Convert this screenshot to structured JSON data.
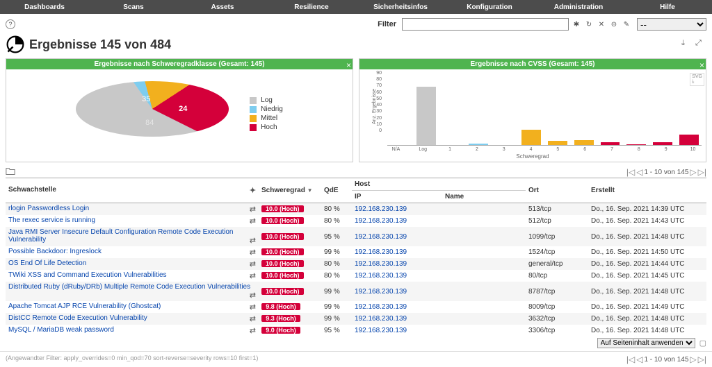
{
  "nav": {
    "items": [
      "Dashboards",
      "Scans",
      "Assets",
      "Resilience",
      "Sicherheitsinfos",
      "Konfiguration",
      "Administration",
      "Hilfe"
    ]
  },
  "filter": {
    "label": "Filter",
    "placeholder": "",
    "value": "",
    "dash": "--"
  },
  "header": {
    "title": "Ergebnisse 145 von 484"
  },
  "panel_pie": {
    "title": "Ergebnisse nach Schweregradklasse (Gesamt: 145)",
    "legend": [
      {
        "label": "Log",
        "color": "#c8c8c8"
      },
      {
        "label": "Niedrig",
        "color": "#7ecdef"
      },
      {
        "label": "Mittel",
        "color": "#f2b01e"
      },
      {
        "label": "Hoch",
        "color": "#d4003a"
      }
    ],
    "slices": {
      "log": 84,
      "niedrig": 2,
      "mittel": 35,
      "hoch": 24
    }
  },
  "panel_bar": {
    "title": "Ergebnisse nach CVSS (Gesamt: 145)",
    "ylabel": "Anz. Ergebnisse",
    "xlabel": "Schweregrad"
  },
  "chart_data": [
    {
      "type": "pie",
      "title": "Ergebnisse nach Schweregradklasse (Gesamt: 145)",
      "categories": [
        "Log",
        "Niedrig",
        "Mittel",
        "Hoch"
      ],
      "values": [
        84,
        2,
        35,
        24
      ],
      "colors": [
        "#c8c8c8",
        "#7ecdef",
        "#f2b01e",
        "#d4003a"
      ]
    },
    {
      "type": "bar",
      "title": "Ergebnisse nach CVSS (Gesamt: 145)",
      "categories": [
        "N/A",
        "Log",
        "1",
        "2",
        "3",
        "4",
        "5",
        "6",
        "7",
        "8",
        "9",
        "10"
      ],
      "values": [
        0,
        84,
        0,
        2,
        0,
        22,
        6,
        7,
        4,
        1,
        4,
        15
      ],
      "colors": [
        "#c8c8c8",
        "#c8c8c8",
        "#7ecdef",
        "#7ecdef",
        "#7ecdef",
        "#f2b01e",
        "#f2b01e",
        "#f2b01e",
        "#d4003a",
        "#d4003a",
        "#d4003a",
        "#d4003a"
      ],
      "xlabel": "Schweregrad",
      "ylabel": "Anz. Ergebnisse",
      "ylim": [
        0,
        90
      ],
      "yticks": [
        0,
        10,
        20,
        30,
        40,
        50,
        60,
        70,
        80,
        90
      ]
    }
  ],
  "pager": {
    "text": "1 - 10 von 145"
  },
  "table": {
    "columns": {
      "vuln": "Schwachstelle",
      "sev": "Schweregrad",
      "qde": "QdE",
      "host": "Host",
      "ip": "IP",
      "name": "Name",
      "ort": "Ort",
      "erstellt": "Erstellt"
    },
    "rows": [
      {
        "vuln": "rlogin Passwordless Login",
        "sev": "10.0 (Hoch)",
        "sev_color": "#d4003a",
        "qde": "80 %",
        "ip": "192.168.230.139",
        "ort": "513/tcp",
        "erstellt": "Do., 16. Sep. 2021 14:39 UTC"
      },
      {
        "vuln": "The rexec service is running",
        "sev": "10.0 (Hoch)",
        "sev_color": "#d4003a",
        "qde": "80 %",
        "ip": "192.168.230.139",
        "ort": "512/tcp",
        "erstellt": "Do., 16. Sep. 2021 14:43 UTC"
      },
      {
        "vuln": "Java RMI Server Insecure Default Configuration Remote Code Execution Vulnerability",
        "sev": "10.0 (Hoch)",
        "sev_color": "#d4003a",
        "qde": "95 %",
        "ip": "192.168.230.139",
        "ort": "1099/tcp",
        "erstellt": "Do., 16. Sep. 2021 14:48 UTC"
      },
      {
        "vuln": "Possible Backdoor: Ingreslock",
        "sev": "10.0 (Hoch)",
        "sev_color": "#d4003a",
        "qde": "99 %",
        "ip": "192.168.230.139",
        "ort": "1524/tcp",
        "erstellt": "Do., 16. Sep. 2021 14:50 UTC"
      },
      {
        "vuln": "OS End Of Life Detection",
        "sev": "10.0 (Hoch)",
        "sev_color": "#d4003a",
        "qde": "80 %",
        "ip": "192.168.230.139",
        "ort": "general/tcp",
        "erstellt": "Do., 16. Sep. 2021 14:44 UTC"
      },
      {
        "vuln": "TWiki XSS and Command Execution Vulnerabilities",
        "sev": "10.0 (Hoch)",
        "sev_color": "#d4003a",
        "qde": "80 %",
        "ip": "192.168.230.139",
        "ort": "80/tcp",
        "erstellt": "Do., 16. Sep. 2021 14:45 UTC"
      },
      {
        "vuln": "Distributed Ruby (dRuby/DRb) Multiple Remote Code Execution Vulnerabilities",
        "sev": "10.0 (Hoch)",
        "sev_color": "#d4003a",
        "qde": "99 %",
        "ip": "192.168.230.139",
        "ort": "8787/tcp",
        "erstellt": "Do., 16. Sep. 2021 14:48 UTC"
      },
      {
        "vuln": "Apache Tomcat AJP RCE Vulnerability (Ghostcat)",
        "sev": "9.8 (Hoch)",
        "sev_color": "#d4003a",
        "qde": "99 %",
        "ip": "192.168.230.139",
        "ort": "8009/tcp",
        "erstellt": "Do., 16. Sep. 2021 14:49 UTC"
      },
      {
        "vuln": "DistCC Remote Code Execution Vulnerability",
        "sev": "9.3 (Hoch)",
        "sev_color": "#d4003a",
        "qde": "99 %",
        "ip": "192.168.230.139",
        "ort": "3632/tcp",
        "erstellt": "Do., 16. Sep. 2021 14:48 UTC"
      },
      {
        "vuln": "MySQL / MariaDB weak password",
        "sev": "9.0 (Hoch)",
        "sev_color": "#d4003a",
        "qde": "95 %",
        "ip": "192.168.230.139",
        "ort": "3306/tcp",
        "erstellt": "Do., 16. Sep. 2021 14:48 UTC"
      }
    ]
  },
  "apply": {
    "label": "Auf Seiteninhalt anwenden"
  },
  "footer": {
    "text": "(Angewandter Filter: apply_overrides=0 min_qod=70 sort-reverse=severity rows=10 first=1)"
  }
}
